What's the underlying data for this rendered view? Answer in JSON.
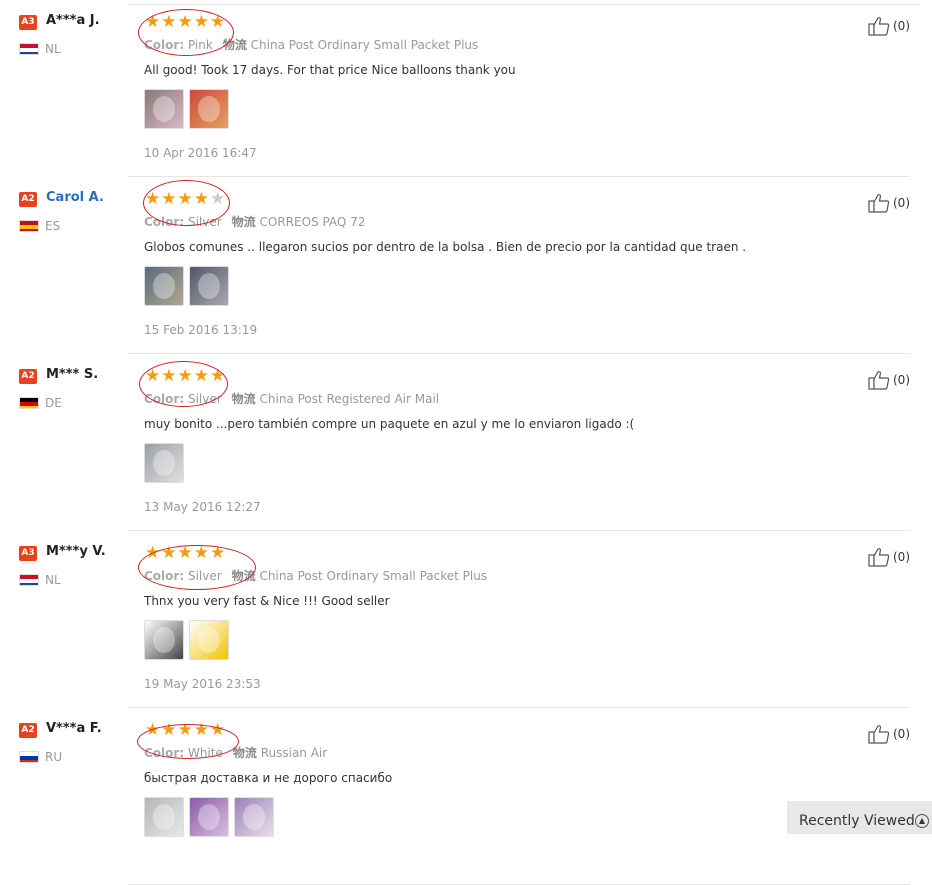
{
  "reviews": [
    {
      "level": "A3",
      "name": "A***a J.",
      "country": "NL",
      "flag": [
        "#c8102e",
        "#ffffff",
        "#21468b"
      ],
      "stars_filled": 5,
      "stars_total": 5,
      "color_label": "Color:",
      "color": "Pink",
      "ship_label": "物流",
      "shipping": "China Post Ordinary Small Packet Plus",
      "comment": "All good! Took 17 days. For that price Nice balloons thank you",
      "photos": [
        "balloon-pink-photo",
        "balloon-pack-photo"
      ],
      "date": "10 Apr 2016 16:47",
      "likes": "(0)",
      "name_link": false
    },
    {
      "level": "A2",
      "name": "Carol A.",
      "country": "ES",
      "flag": [
        "#c60b1e",
        "#ffc400",
        "#c60b1e"
      ],
      "stars_filled": 4,
      "stars_total": 5,
      "color_label": "Color:",
      "color": "Silver",
      "ship_label": "物流",
      "shipping": "CORREOS PAQ 72",
      "comment": "Globos comunes .. llegaron sucios por dentro de la bolsa . Bien de precio por la cantidad que traen .",
      "photos": [
        "balloon-bag-photo",
        "balloon-bag-photo-2"
      ],
      "date": "15 Feb 2016 13:19",
      "likes": "(0)",
      "name_link": true
    },
    {
      "level": "A2",
      "name": "M*** S.",
      "country": "DE",
      "flag": [
        "#000000",
        "#dd0000",
        "#ffce00"
      ],
      "stars_filled": 5,
      "stars_total": 5,
      "color_label": "Color:",
      "color": "Silver",
      "ship_label": "物流",
      "shipping": "China Post Registered Air Mail",
      "comment": "muy bonito ...pero también compre un paquete en azul y me lo enviaron ligado :(",
      "photos": [
        "balloon-package-photo"
      ],
      "date": "13 May 2016 12:27",
      "likes": "(0)",
      "name_link": false
    },
    {
      "level": "A3",
      "name": "M***y V.",
      "country": "NL",
      "flag": [
        "#c8102e",
        "#ffffff",
        "#21468b"
      ],
      "stars_filled": 5,
      "stars_total": 5,
      "color_label": "Color:",
      "color": "Silver",
      "ship_label": "物流",
      "shipping": "China Post Ordinary Small Packet Plus",
      "comment": "Thnx you very fast & Nice !!! Good seller",
      "photos": [
        "thank-you-note-photo",
        "very-good-emoji-photo"
      ],
      "date": "19 May 2016 23:53",
      "likes": "(0)",
      "name_link": false
    },
    {
      "level": "A2",
      "name": "V***a F.",
      "country": "RU",
      "flag": [
        "#ffffff",
        "#0039a6",
        "#d52b1e"
      ],
      "stars_filled": 5,
      "stars_total": 5,
      "color_label": "Color:",
      "color": "White",
      "ship_label": "物流",
      "shipping": "Russian Air",
      "comment": "быстрая доставка и не дорого спасибо",
      "photos": [
        "balloon-white-photo",
        "balloon-purple-photo",
        "balloon-lilac-photo"
      ],
      "date": "",
      "likes": "(0)",
      "name_link": false
    }
  ],
  "recently_viewed": {
    "label": "Recently Viewed"
  },
  "colors": {
    "star": "#f39c12",
    "badge": "#e6421e",
    "annotation_circle": "#cc2222",
    "link": "#2a6ebb"
  }
}
